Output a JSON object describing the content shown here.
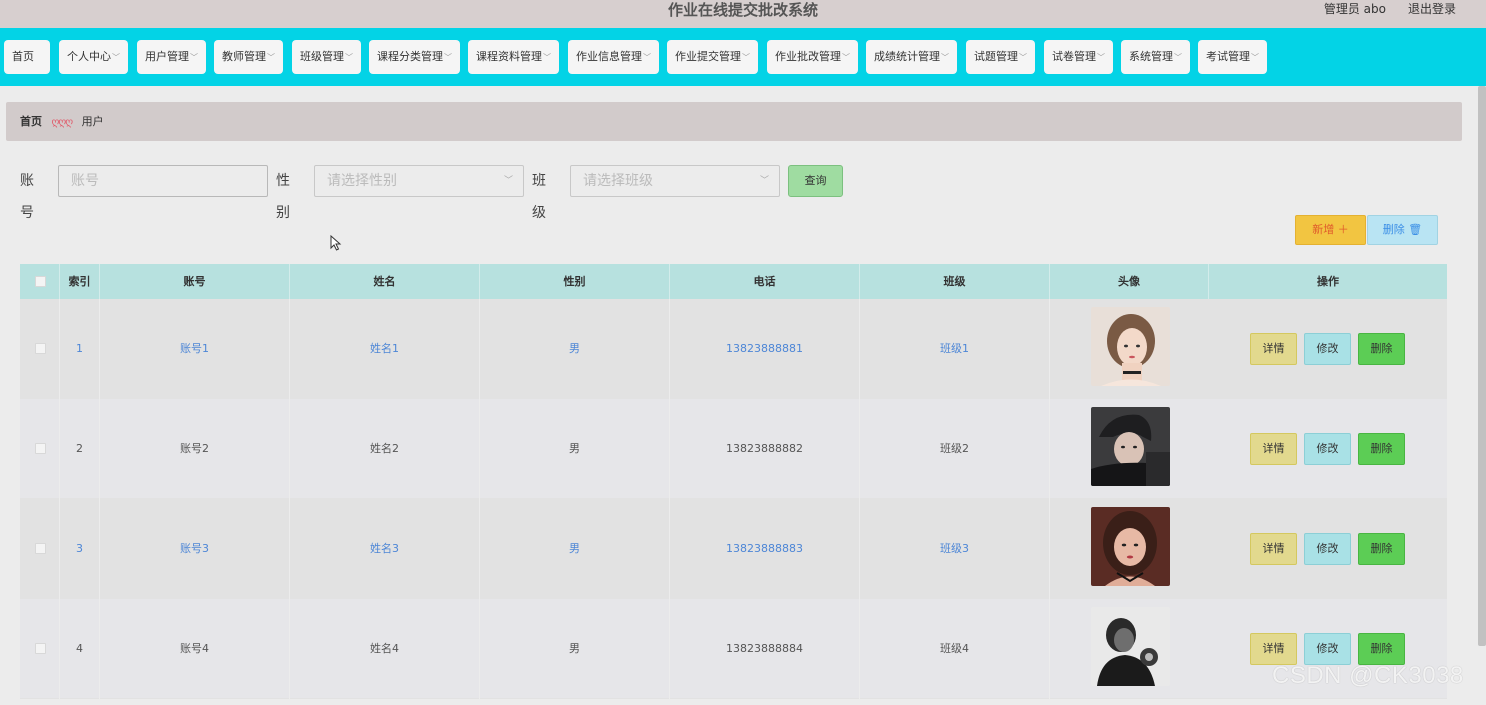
{
  "header": {
    "app_title": "作业在线提交批改系统",
    "user": "管理员 abo",
    "logout": "退出登录"
  },
  "nav": [
    {
      "label": "首页",
      "dropdown": false
    },
    {
      "label": "个人中心",
      "dropdown": true
    },
    {
      "label": "用户管理",
      "dropdown": true
    },
    {
      "label": "教师管理",
      "dropdown": true
    },
    {
      "label": "班级管理",
      "dropdown": true
    },
    {
      "label": "课程分类管理",
      "dropdown": true
    },
    {
      "label": "课程资料管理",
      "dropdown": true
    },
    {
      "label": "作业信息管理",
      "dropdown": true
    },
    {
      "label": "作业提交管理",
      "dropdown": true
    },
    {
      "label": "作业批改管理",
      "dropdown": true
    },
    {
      "label": "成绩统计管理",
      "dropdown": true
    },
    {
      "label": "试题管理",
      "dropdown": true
    },
    {
      "label": "试卷管理",
      "dropdown": true
    },
    {
      "label": "系统管理",
      "dropdown": true
    },
    {
      "label": "考试管理",
      "dropdown": true
    }
  ],
  "breadcrumb": {
    "home": "首页",
    "separator": "ღღღ",
    "current": "用户"
  },
  "search": {
    "account_label": "账号",
    "account_placeholder": "账号",
    "gender_label": "性别",
    "gender_placeholder": "请选择性别",
    "class_label": "班级",
    "class_placeholder": "请选择班级",
    "query_button": "查询"
  },
  "actions": {
    "add_button": "新增 ＋",
    "delete_button": "删除 🗑"
  },
  "table": {
    "columns": [
      "索引",
      "账号",
      "姓名",
      "性别",
      "电话",
      "班级",
      "头像",
      "操作"
    ],
    "rows": [
      {
        "index": "1",
        "account": "账号1",
        "name": "姓名1",
        "gender": "男",
        "phone": "13823888881",
        "class": "班级1",
        "avatar": "female-portrait"
      },
      {
        "index": "2",
        "account": "账号2",
        "name": "姓名2",
        "gender": "男",
        "phone": "13823888882",
        "class": "班级2",
        "avatar": "male-portrait"
      },
      {
        "index": "3",
        "account": "账号3",
        "name": "姓名3",
        "gender": "男",
        "phone": "13823888883",
        "class": "班级3",
        "avatar": "female-portrait"
      },
      {
        "index": "4",
        "account": "账号4",
        "name": "姓名4",
        "gender": "男",
        "phone": "13823888884",
        "class": "班级4",
        "avatar": "male-portrait-bw"
      }
    ],
    "row_actions": {
      "detail": "详情",
      "edit": "修改",
      "delete": "删除"
    }
  },
  "watermark": "CSDN @CK3038",
  "colors": {
    "navbar": "#03d3e6",
    "topbar": "#d7cfcf",
    "table_header": "#b7e1df",
    "link": "#4d86d6"
  }
}
